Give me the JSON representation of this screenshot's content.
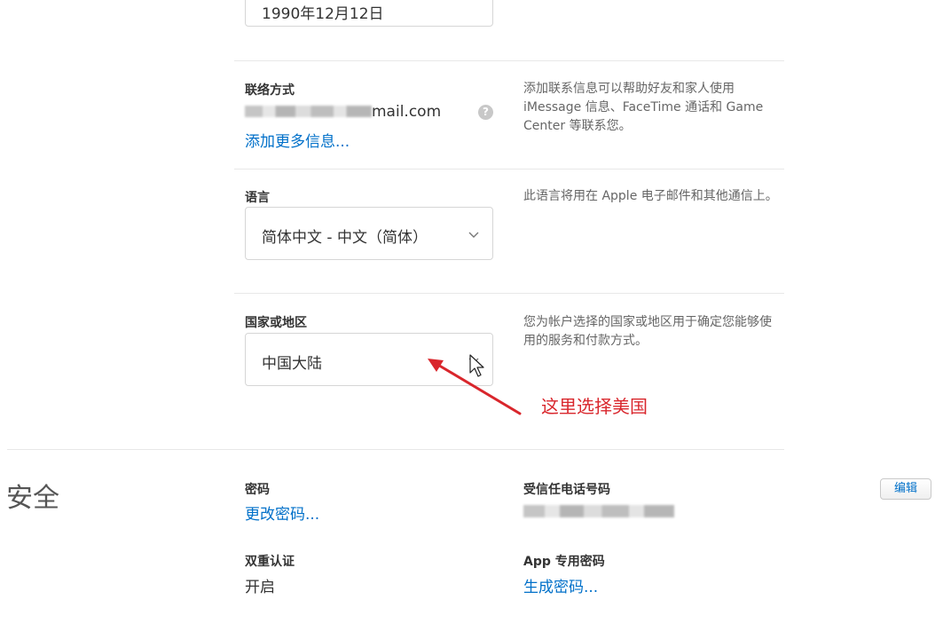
{
  "birthday": {
    "value": "1990年12月12日"
  },
  "contact": {
    "label": "联络方式",
    "email_visible_suffix": "mail.com",
    "add_more_link": "添加更多信息...",
    "help": "添加联系信息可以帮助好友和家人使用 iMessage 信息、FaceTime 通话和 Game Center 等联系您。"
  },
  "language": {
    "label": "语言",
    "selected": "简体中文 - 中文（简体）",
    "help": "此语言将用在 Apple 电子邮件和其他通信上。"
  },
  "country": {
    "label": "国家或地区",
    "selected": "中国大陆",
    "help": "您为帐户选择的国家或地区用于确定您能够使用的服务和付款方式。"
  },
  "annotation": {
    "text": "这里选择美国",
    "color": "#d9262c"
  },
  "security": {
    "heading": "安全",
    "edit_button": "编辑",
    "password_label": "密码",
    "change_password_link": "更改密码...",
    "trusted_phone_label": "受信任电话号码",
    "two_factor_label": "双重认证",
    "two_factor_value": "开启",
    "app_password_label": "App 专用密码",
    "generate_password_link": "生成密码..."
  },
  "colors": {
    "link": "#0070c9",
    "annotation": "#d9262c"
  }
}
